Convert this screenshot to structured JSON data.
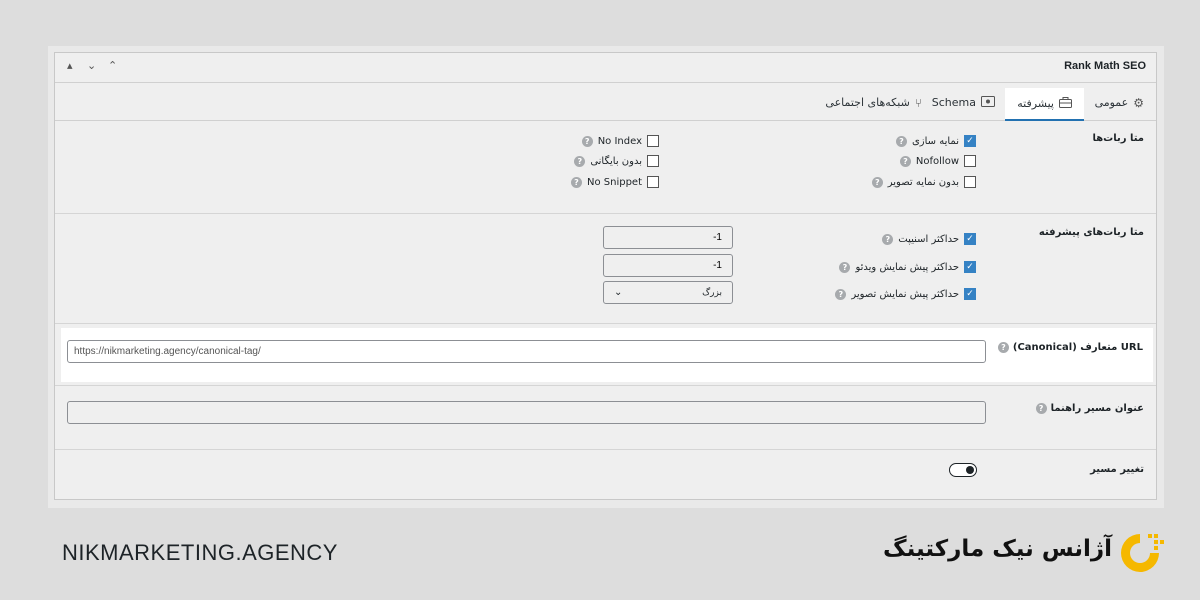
{
  "header": {
    "title": "Rank Math SEO",
    "controls": [
      "▴",
      "⌄",
      "⌃"
    ]
  },
  "tabs": [
    {
      "label": "عمومی",
      "icon": "gear-icon"
    },
    {
      "label": "پیشرفته",
      "icon": "toolbox-icon",
      "active": true
    },
    {
      "label": "Schema",
      "icon": "schema-icon"
    },
    {
      "label": "شبکه‌های اجتماعی",
      "icon": "share-icon"
    }
  ],
  "robots_meta": {
    "title": "متا ربات‌ها",
    "right_column": [
      {
        "label": "نمایه سازی",
        "checked": true
      },
      {
        "label": "Nofollow",
        "checked": false
      },
      {
        "label": "بدون نمایه تصویر",
        "checked": false
      }
    ],
    "left_column": [
      {
        "label": "No Index",
        "checked": false
      },
      {
        "label": "بدون بایگانی",
        "checked": false
      },
      {
        "label": "No Snippet",
        "checked": false
      }
    ]
  },
  "advanced_robots": {
    "title": "متا ربات‌های پیشرفته",
    "items": [
      {
        "label": "حداکثر اسنیپت",
        "checked": true,
        "value": "-1"
      },
      {
        "label": "حداکثر پیش نمایش ویدئو",
        "checked": true,
        "value": "-1"
      },
      {
        "label": "حداکثر پیش نمایش تصویر",
        "checked": true,
        "value": "بزرگ"
      }
    ]
  },
  "canonical": {
    "title": "URL متعارف (Canonical)",
    "value": "https://nikmarketing.agency/canonical-tag/"
  },
  "breadcrumb": {
    "title": "عنوان مسیر راهنما",
    "value": ""
  },
  "redirect": {
    "title": "تغییر مسیر",
    "enabled": true
  },
  "footer": {
    "domain": "NIKMARKETING.AGENCY",
    "brand": "آژانس نیک مارکتینگ"
  },
  "colors": {
    "accent": "#2271b1",
    "checkbox": "#3582c4",
    "logo": "#f5b800"
  }
}
